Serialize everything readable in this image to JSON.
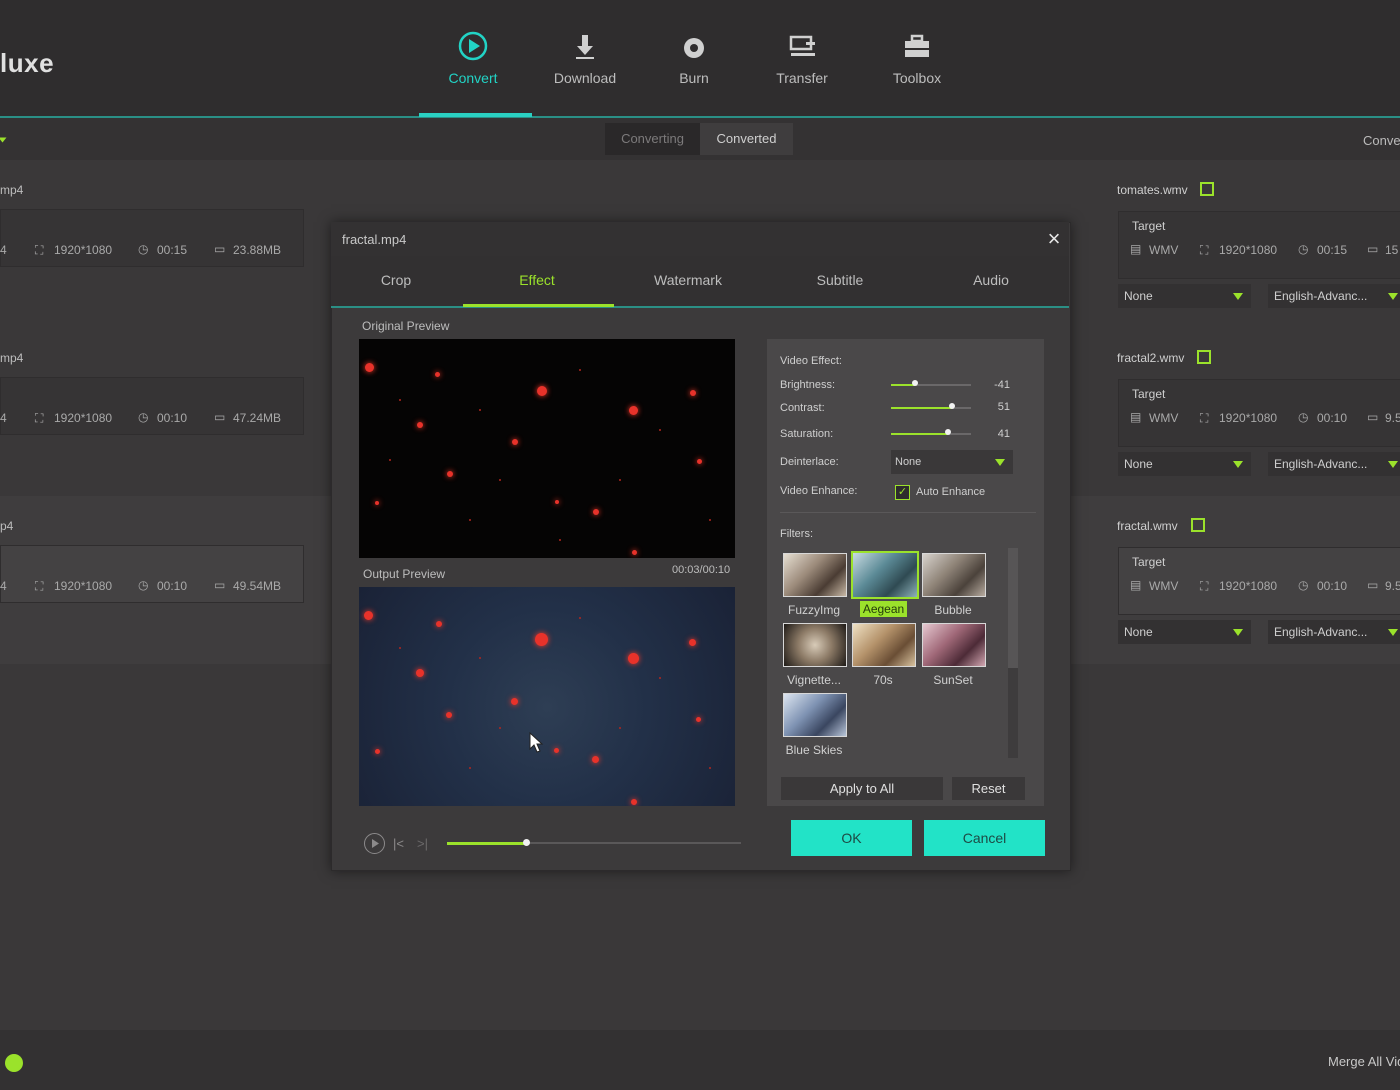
{
  "app": {
    "title": "luxe"
  },
  "nav": {
    "items": [
      {
        "label": "Convert",
        "icon": "convert-icon",
        "active": true
      },
      {
        "label": "Download",
        "icon": "download-icon"
      },
      {
        "label": "Burn",
        "icon": "burn-icon"
      },
      {
        "label": "Transfer",
        "icon": "transfer-icon"
      },
      {
        "label": "Toolbox",
        "icon": "toolbox-icon"
      }
    ]
  },
  "subbar": {
    "converting": "Converting",
    "converted": "Converted",
    "right_label": "Conve"
  },
  "files": [
    {
      "name": "mp4",
      "left_letter": "4",
      "resolution": "1920*1080",
      "duration": "00:15",
      "size": "23.88MB",
      "target_name": "tomates.wmv",
      "target_label": "Target",
      "format": "WMV",
      "t_res": "1920*1080",
      "t_dur": "00:15",
      "t_size": "15",
      "subtitle": "None",
      "audio": "English-Advanc..."
    },
    {
      "name": "mp4",
      "left_letter": "4",
      "resolution": "1920*1080",
      "duration": "00:10",
      "size": "47.24MB",
      "target_name": "fractal2.wmv",
      "target_label": "Target",
      "format": "WMV",
      "t_res": "1920*1080",
      "t_dur": "00:10",
      "t_size": "9.5",
      "subtitle": "None",
      "audio": "English-Advanc..."
    },
    {
      "name": "p4",
      "left_letter": "4",
      "resolution": "1920*1080",
      "duration": "00:10",
      "size": "49.54MB",
      "target_name": "fractal.wmv",
      "target_label": "Target",
      "format": "WMV",
      "t_res": "1920*1080",
      "t_dur": "00:10",
      "t_size": "9.5",
      "subtitle": "None",
      "audio": "English-Advanc..."
    }
  ],
  "modal": {
    "title": "fractal.mp4",
    "tabs": [
      "Crop",
      "Effect",
      "Watermark",
      "Subtitle",
      "Audio"
    ],
    "active_tab": "Effect",
    "original_preview_label": "Original Preview",
    "output_preview_label": "Output Preview",
    "time": "00:03/00:10",
    "playback_progress": 0.27,
    "effects": {
      "heading": "Video Effect:",
      "brightness": {
        "label": "Brightness:",
        "value": "-41",
        "fraction": 0.3
      },
      "contrast": {
        "label": "Contrast:",
        "value": "51",
        "fraction": 0.76
      },
      "saturation": {
        "label": "Saturation:",
        "value": "41",
        "fraction": 0.71
      },
      "deinterlace": {
        "label": "Deinterlace:",
        "value": "None"
      },
      "enhance": {
        "label": "Video Enhance:",
        "checkbox_label": "Auto Enhance",
        "checked": true
      }
    },
    "filters": {
      "heading": "Filters:",
      "items": [
        {
          "name": "FuzzyImg"
        },
        {
          "name": "Aegean",
          "selected": true
        },
        {
          "name": "Bubble"
        },
        {
          "name": "Vignette..."
        },
        {
          "name": "70s"
        },
        {
          "name": "SunSet"
        },
        {
          "name": "Blue Skies"
        }
      ]
    },
    "buttons": {
      "apply_all": "Apply to All",
      "reset": "Reset",
      "ok": "OK",
      "cancel": "Cancel"
    }
  },
  "footer": {
    "merge_label": "Merge All Vid"
  },
  "colors": {
    "accent_green": "#9be22b",
    "accent_teal": "#22d3c5",
    "button_teal": "#22e3c7"
  }
}
